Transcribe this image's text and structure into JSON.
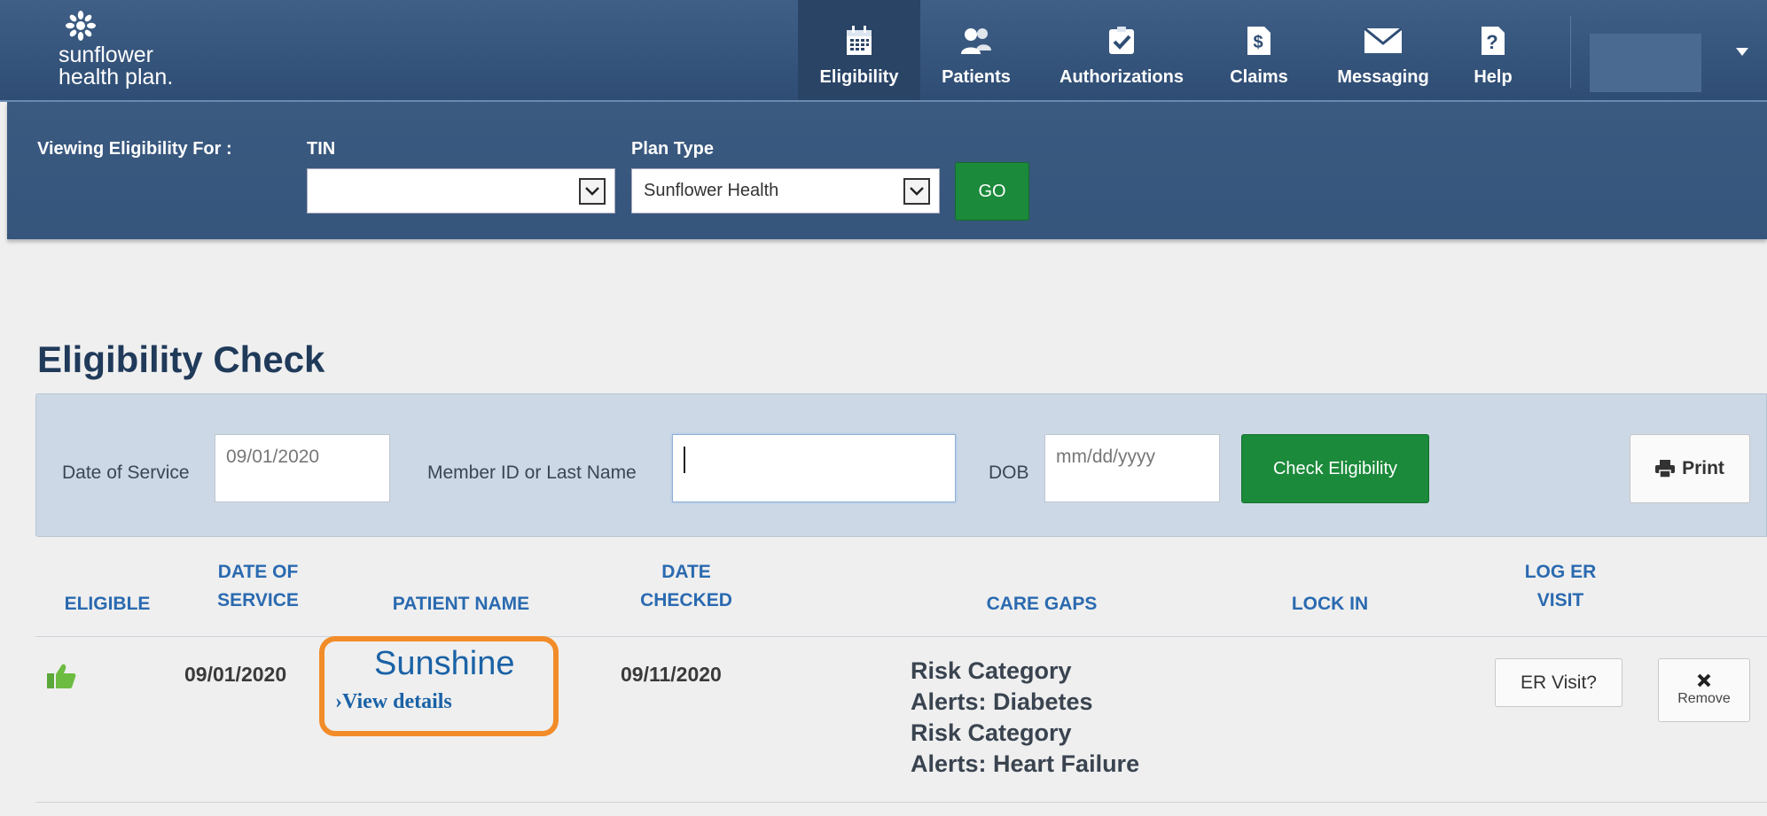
{
  "brand": {
    "line1": "sunflower",
    "line2": "health plan."
  },
  "nav": {
    "items": [
      {
        "label": "Eligibility",
        "icon": "calendar-icon",
        "active": true
      },
      {
        "label": "Patients",
        "icon": "users-icon",
        "active": false
      },
      {
        "label": "Authorizations",
        "icon": "checkbox-icon",
        "active": false
      },
      {
        "label": "Claims",
        "icon": "dollar-document-icon",
        "active": false
      },
      {
        "label": "Messaging",
        "icon": "envelope-icon",
        "active": false
      },
      {
        "label": "Help",
        "icon": "help-icon",
        "active": false
      }
    ]
  },
  "filter": {
    "viewing_label": "Viewing Eligibility For :",
    "tin_label": "TIN",
    "tin_value": "",
    "plan_label": "Plan Type",
    "plan_value": "Sunflower Health",
    "go_label": "GO"
  },
  "page": {
    "title": "Eligibility Check"
  },
  "search": {
    "dos_label": "Date of Service",
    "dos_value": "09/01/2020",
    "member_label": "Member ID or Last Name",
    "member_value": "",
    "dob_label": "DOB",
    "dob_placeholder": "mm/dd/yyyy",
    "check_label": "Check Eligibility",
    "print_label": "Print"
  },
  "table": {
    "headers": {
      "eligible": "ELIGIBLE",
      "dos_1": "DATE OF",
      "dos_2": "SERVICE",
      "patient": "PATIENT NAME",
      "checked_1": "DATE",
      "checked_2": "CHECKED",
      "care_gaps": "CARE GAPS",
      "lock_in": "LOCK IN",
      "er_1": "LOG ER",
      "er_2": "VISIT"
    },
    "rows": [
      {
        "eligible_icon": "thumbs-up-icon",
        "date_of_service": "09/01/2020",
        "patient_name": "Sunshine",
        "view_details": "View details",
        "date_checked": "09/11/2020",
        "care_gaps": [
          "Risk Category",
          "Alerts: Diabetes",
          "Risk Category",
          "Alerts: Heart Failure"
        ],
        "lock_in": "",
        "er_label": "ER Visit?",
        "remove_label": "Remove"
      }
    ]
  },
  "colors": {
    "nav_bg": "#35557c",
    "accent_green": "#1b8a3a",
    "link_blue": "#1a62a6",
    "header_blue": "#2a6ab0",
    "highlight": "#f28c28"
  }
}
